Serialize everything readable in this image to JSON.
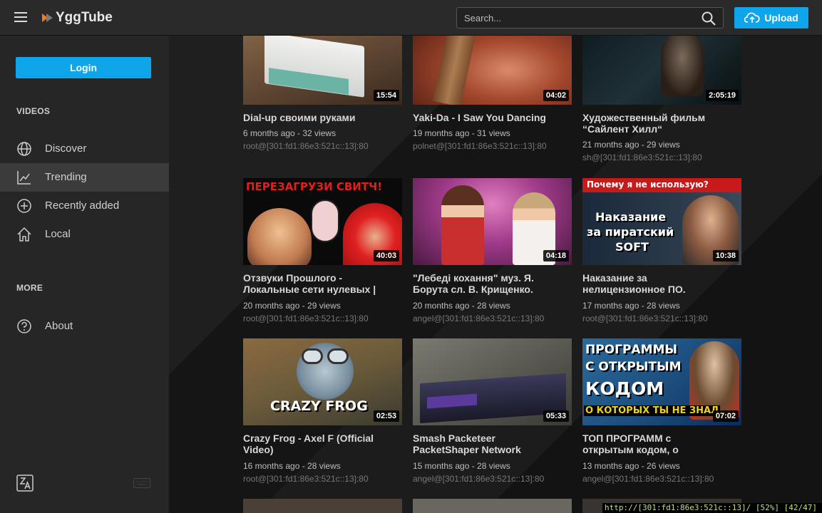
{
  "header": {
    "logo_text": "YggTube",
    "search_placeholder": "Search...",
    "upload_label": "Upload"
  },
  "sidebar": {
    "login_label": "Login",
    "videos_title": "VIDEOS",
    "more_title": "MORE",
    "items": [
      {
        "label": "Discover",
        "icon": "globe-icon"
      },
      {
        "label": "Trending",
        "icon": "trending-icon",
        "active": true
      },
      {
        "label": "Recently added",
        "icon": "plus-circle-icon"
      },
      {
        "label": "Local",
        "icon": "home-icon"
      },
      {
        "label": "About",
        "icon": "help-circle-icon"
      }
    ]
  },
  "videos": [
    {
      "title": "Dial-up своими руками",
      "title2": "",
      "meta": "6 months ago - 32 views",
      "channel": "root@[301:fd1:86e3:521c::13]:80",
      "duration": "15:54"
    },
    {
      "title": "Yaki-Da - I Saw You Dancing",
      "title2": "",
      "meta": "19 months ago - 31 views",
      "channel": "polnet@[301:fd1:86e3:521c::13]:80",
      "duration": "04:02"
    },
    {
      "title": "Художественный фильм",
      "title2": "“Сайлент Хилл“",
      "meta": "21 months ago - 29 views",
      "channel": "sh@[301:fd1:86e3:521c::13]:80",
      "duration": "2:05:19"
    },
    {
      "title": "Отзвуки Прошлого -",
      "title2": "Локальные сети нулевых |",
      "meta": "20 months ago - 29 views",
      "channel": "root@[301:fd1:86e3:521c::13]:80",
      "duration": "40:03",
      "thumb_text": "ПЕРЕЗАГРУЗИ СВИТЧ!"
    },
    {
      "title": "\"Лебеді кохання\" муз. Я.",
      "title2": "Борута сл. В. Крищенко.",
      "meta": "20 months ago - 28 views",
      "channel": "angel@[301:fd1:86e3:521c::13]:80",
      "duration": "04:18"
    },
    {
      "title": "Наказание за",
      "title2": "нелицензионное ПО.",
      "meta": "17 months ago - 28 views",
      "channel": "root@[301:fd1:86e3:521c::13]:80",
      "duration": "10:38",
      "thumb_text": "Почему я не использую?",
      "thumb_text2": "Наказание",
      "thumb_text3": "за пиратский",
      "thumb_text4": "SOFT"
    },
    {
      "title": "Crazy Frog - Axel F (Official",
      "title2": "Video)",
      "meta": "16 months ago - 28 views",
      "channel": "root@[301:fd1:86e3:521c::13]:80",
      "duration": "02:53",
      "thumb_text": "CRAZY FROG"
    },
    {
      "title": "Smash Packeteer",
      "title2": "PacketShaper Network",
      "meta": "15 months ago - 28 views",
      "channel": "angel@[301:fd1:86e3:521c::13]:80",
      "duration": "05:33"
    },
    {
      "title": "ТОП ПРОГРАММ с",
      "title2": "открытым кодом, о",
      "meta": "13 months ago - 26 views",
      "channel": "angel@[301:fd1:86e3:521c::13]:80",
      "duration": "07:02",
      "thumb_text": "ПРОГРАММЫ",
      "thumb_text2": "С ОТКРЫТЫМ",
      "thumb_text3": "КОДОМ",
      "thumb_text4": "О КОТОРЫХ ТЫ НЕ ЗНАЛ"
    }
  ],
  "statusbar": "http://[301:fd1:86e3:521c::13]/ [52%] [42/47]",
  "colors": {
    "accent": "#0ea5ea",
    "sidebar": "#262626",
    "header": "#2a2a2a"
  }
}
